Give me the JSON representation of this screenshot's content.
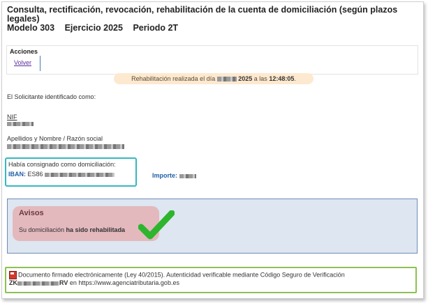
{
  "header": {
    "title": "Consulta, rectificación, revocación, rehabilitación de la cuenta de domiciliación (según plazos legales)",
    "modelo": "Modelo 303",
    "ejercicio": "Ejercicio 2025",
    "periodo": "Periodo 2T"
  },
  "acciones": {
    "label": "Acciones",
    "volver": "Volver"
  },
  "banner": {
    "prefix": "Rehabilitación realizada el día",
    "year": "2025",
    "middle": "a las",
    "time": "12:48:05",
    "suffix": "."
  },
  "solicitante": {
    "intro": "El Solicitante identificado como:",
    "nif_label": "NIF",
    "nombre_label": "Apellidos y Nombre / Razón social"
  },
  "domiciliacion": {
    "label": "Había consignado como domiciliación:",
    "iban_label": "IBAN:",
    "iban_prefix": "ES86",
    "importe_label": "Importe:"
  },
  "avisos": {
    "title": "Avisos",
    "message_prefix": "Su domiciliación",
    "message_bold": "ha sido rehabilitada",
    "check_color": "#2db52d"
  },
  "documento": {
    "line1": "Documento firmado electrónicamente (Ley 40/2015). Autenticidad verificable mediante Código Seguro de Verificación",
    "csv_start": "ZK",
    "csv_end": "RV",
    "line2_suffix": "en https://www.agenciatributaria.gob.es"
  },
  "colors": {
    "domiciliacion_highlight": "#35b8c0",
    "documento_highlight": "#8cc152",
    "avisos_bg": "#e3b9bd",
    "banner_bg": "#fde9cf"
  }
}
